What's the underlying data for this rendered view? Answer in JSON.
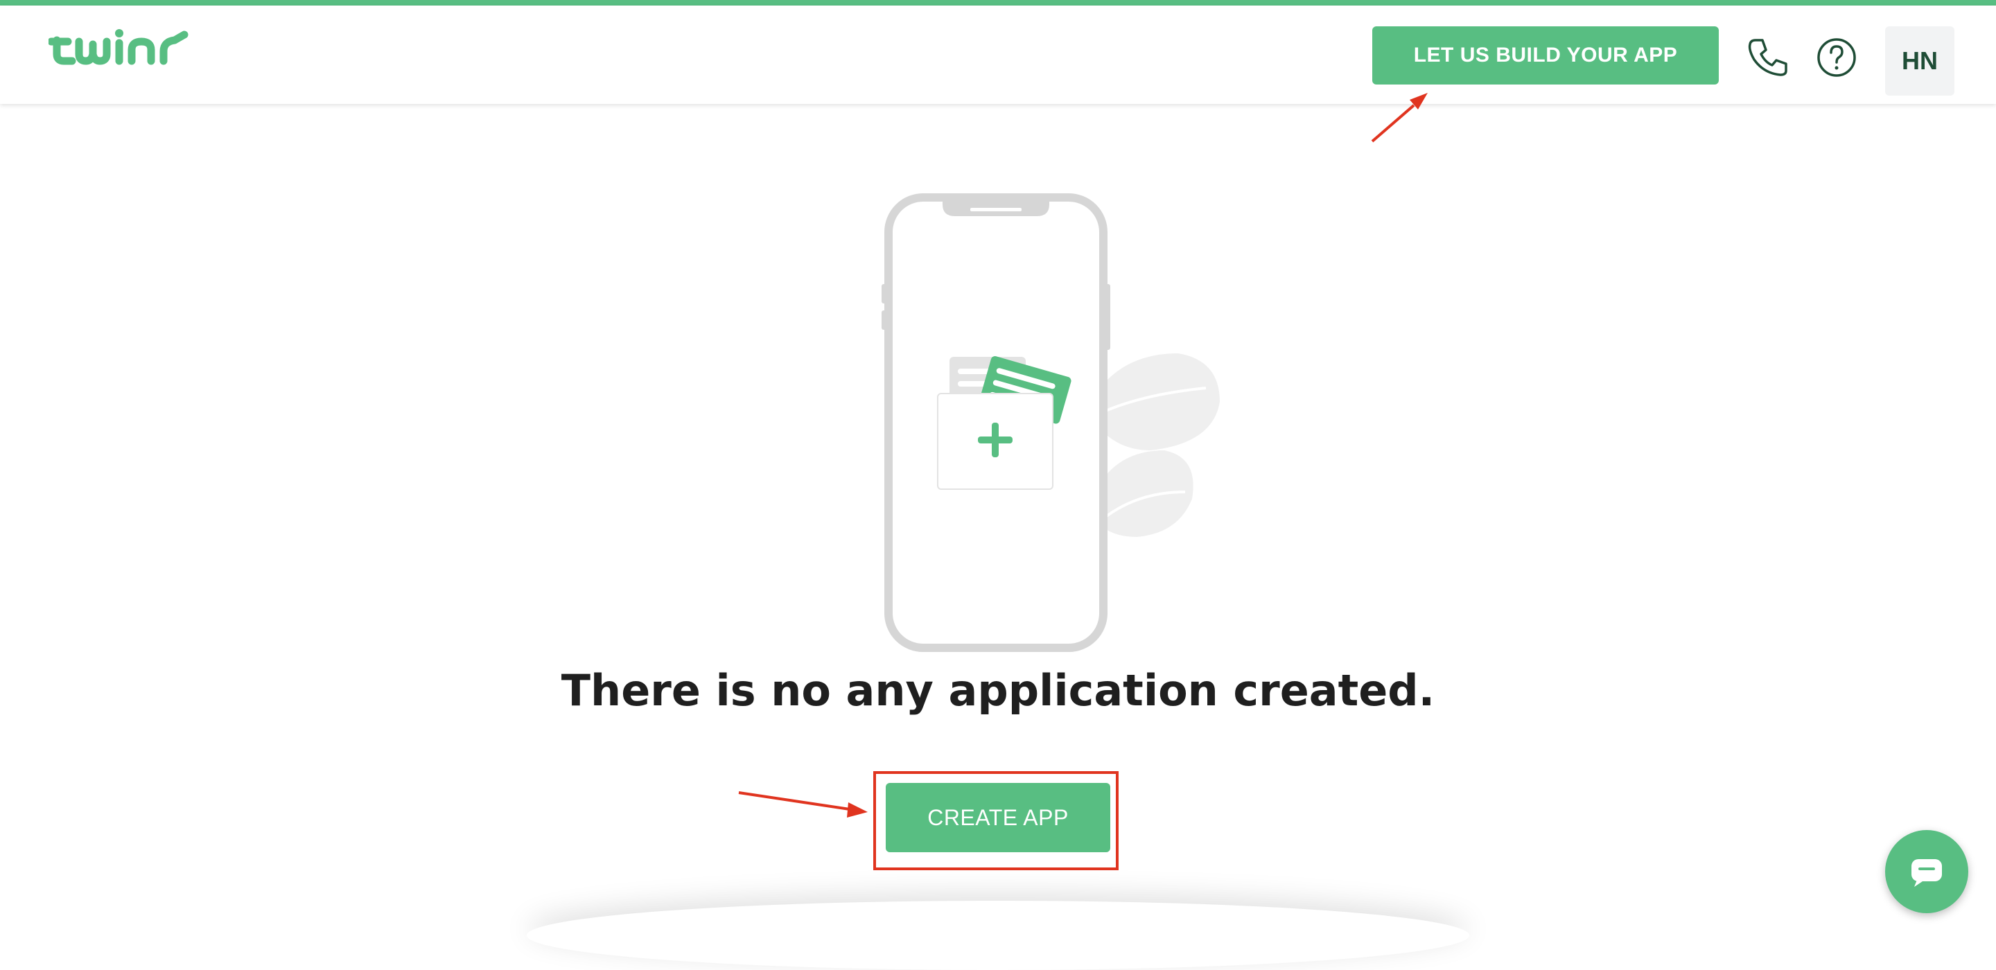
{
  "header": {
    "logo_text": "twinr",
    "build_button_label": "LET US BUILD YOUR APP",
    "phone_icon": "phone-icon",
    "help_icon": "help-circle-icon",
    "avatar_initials": "HN"
  },
  "main": {
    "empty_message": "There is no any application created.",
    "create_button_label": "CREATE APP"
  },
  "chat": {
    "icon": "chat-bubble-icon"
  },
  "colors": {
    "brand_green": "#58be82",
    "annotation_red": "#e0341f",
    "text_dark": "#1f1f1f"
  }
}
